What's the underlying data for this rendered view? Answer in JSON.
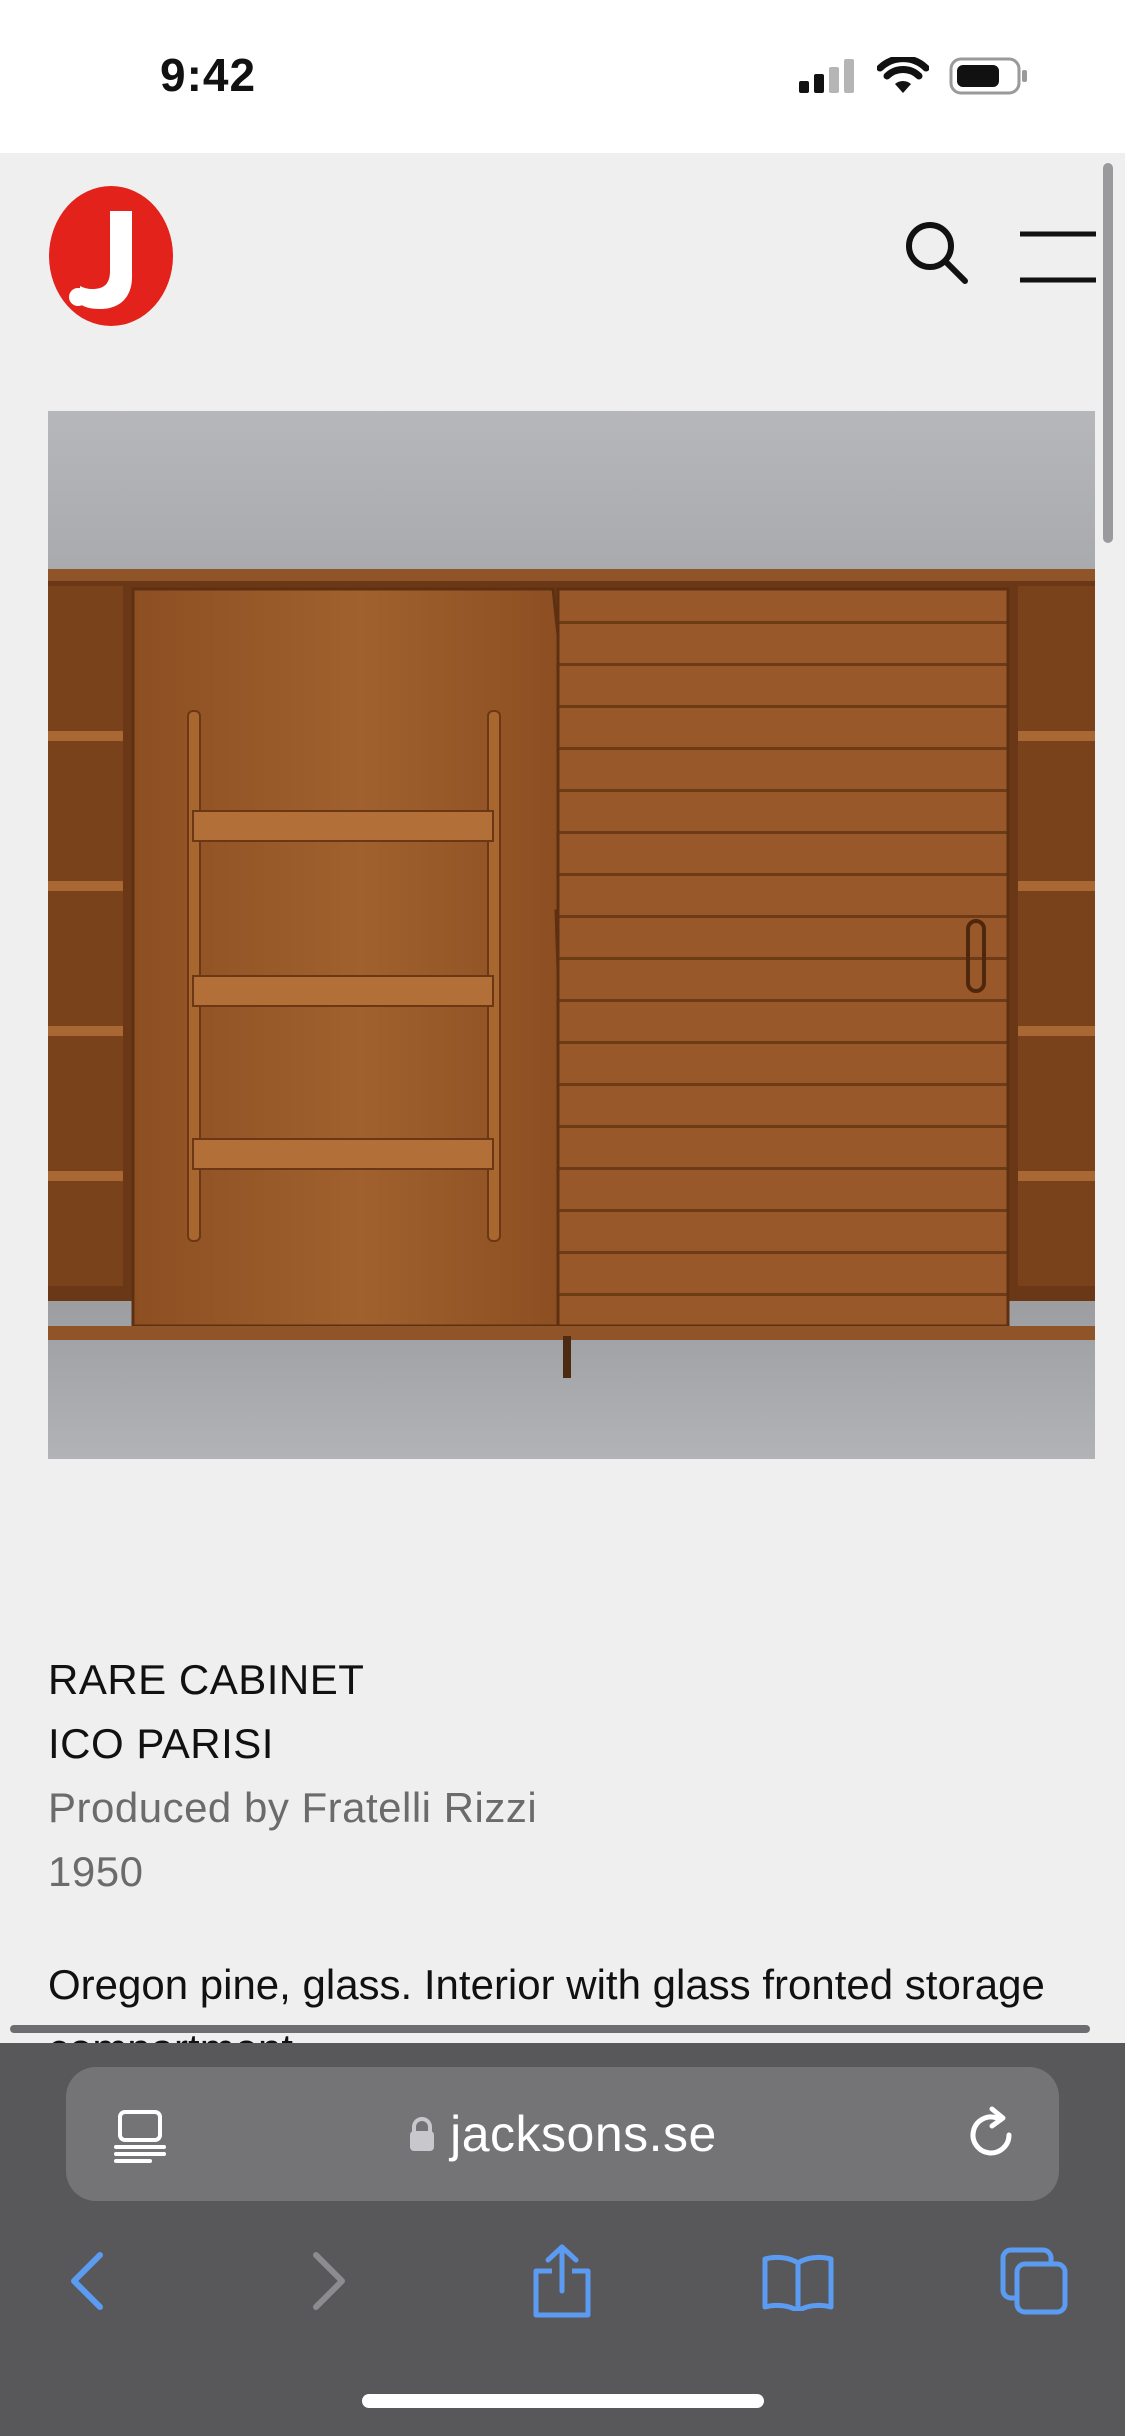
{
  "status_bar": {
    "time": "9:42",
    "icons": [
      "signal-icon",
      "wifi-icon",
      "battery-icon"
    ]
  },
  "header": {
    "logo_letter": "J",
    "logo_color": "#e3221b",
    "icons": [
      "search-icon",
      "hamburger-menu-icon"
    ]
  },
  "product": {
    "title": "RARE CABINET",
    "designer": "ICO PARISI",
    "producer": "Produced by Fratelli Rizzi",
    "year": "1950",
    "description": "Oregon pine, glass. Interior with glass fronted storage compartment."
  },
  "browser": {
    "url": "jacksons.se",
    "reader_icon": "reader-mode-icon",
    "lock_icon": "lock-icon",
    "reload_icon": "reload-icon",
    "toolbar": [
      "back-icon",
      "forward-icon",
      "share-icon",
      "bookmarks-icon",
      "tabs-icon"
    ],
    "accent_color": "#5b9bf2"
  },
  "colors": {
    "page_background": "#efeff0",
    "chrome_background": "#58585b"
  }
}
